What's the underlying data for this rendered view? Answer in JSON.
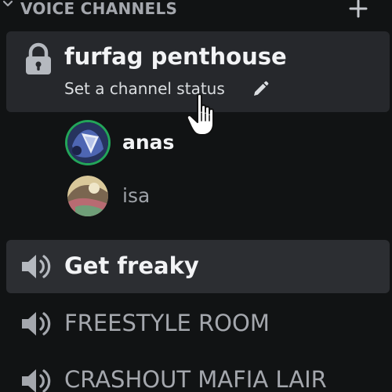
{
  "category": {
    "label": "VOICE CHANNELS",
    "collapse_icon": "chevron-down-icon",
    "add_icon": "plus-icon"
  },
  "selected_channel": {
    "name": "furfag penthouse",
    "status_placeholder": "Set a channel status",
    "icon": "lock-icon",
    "edit_icon": "pencil-icon"
  },
  "connected_users": [
    {
      "name": "anas",
      "speaking": true
    },
    {
      "name": "isa",
      "speaking": false
    }
  ],
  "voice_channels": [
    {
      "name": "Get freaky",
      "icon": "speaker-icon"
    },
    {
      "name": "FREESTYLE ROOM",
      "icon": "speaker-icon"
    },
    {
      "name": "CRASHOUT MAFIA LAIR",
      "icon": "speaker-icon"
    }
  ],
  "colors": {
    "background": "#111314",
    "selected_bg": "#26282c",
    "hover_bg": "#2c2e32",
    "speaking_ring": "#23a55a",
    "text_bright": "#f2f3f5",
    "text_muted": "#a4a7ad"
  }
}
